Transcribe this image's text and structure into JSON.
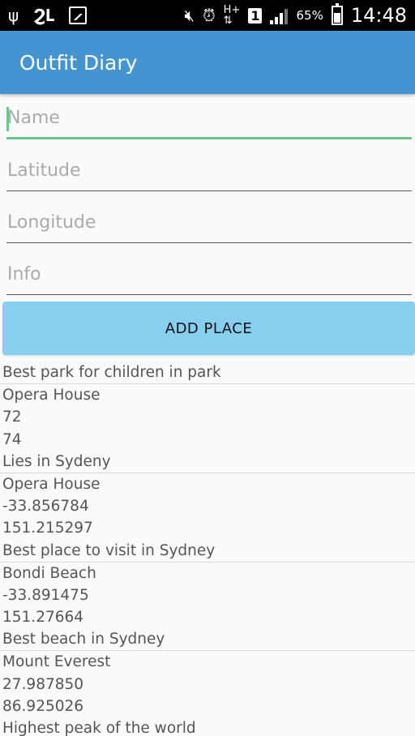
{
  "status_bar": {
    "battery_percent": "65%",
    "time": "14:48",
    "icons": [
      "usb-icon",
      "voicemail-icon",
      "image-icon",
      "mute-icon",
      "alarm-icon",
      "network-hplus-icon",
      "sim-icon",
      "signal-icon",
      "battery-charging-icon"
    ]
  },
  "app_bar": {
    "title": "Outfit Diary",
    "color": "#4494d2"
  },
  "form": {
    "name_placeholder": "Name",
    "latitude_placeholder": "Latitude",
    "longitude_placeholder": "Longitude",
    "info_placeholder": "Info",
    "add_button_label": "ADD PLACE",
    "accent_color": "#6cc38b",
    "button_color": "#87cfef"
  },
  "places": [
    {
      "lines": [
        "Best park for children in park"
      ]
    },
    {
      "lines": [
        "Opera House",
        "72",
        "74",
        "Lies in Sydeny"
      ]
    },
    {
      "lines": [
        "Opera House",
        "-33.856784",
        "151.215297",
        "Best place to visit in Sydney"
      ]
    },
    {
      "lines": [
        "Bondi Beach",
        "-33.891475",
        "151.27664",
        "Best beach in Sydney"
      ]
    },
    {
      "lines": [
        "Mount Everest",
        "27.987850",
        "86.925026",
        "Highest peak of the world"
      ]
    }
  ]
}
